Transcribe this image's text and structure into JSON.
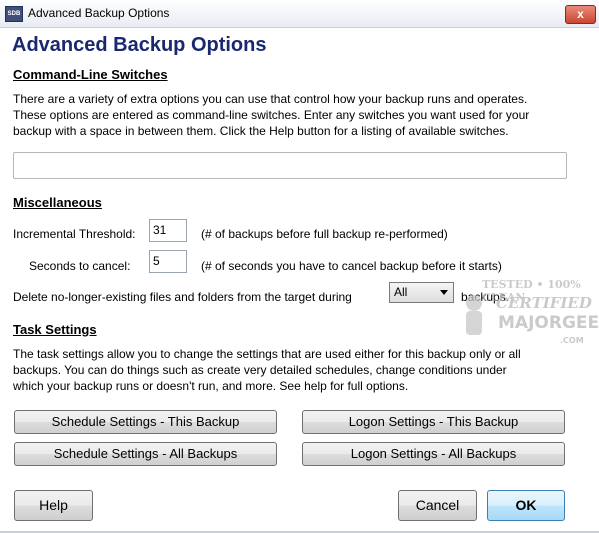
{
  "window": {
    "title": "Advanced Backup Options",
    "close_glyph": "x",
    "icon": "app-icon",
    "icon_text": "SDB"
  },
  "heading": "Advanced Backup Options",
  "cmdline": {
    "heading": "Command-Line Switches",
    "description_lines": [
      "There are a variety of extra options you can use that control how your backup runs and operates.",
      "These options are entered as command-line switches. Enter any switches you want used for your",
      "backup with a space in between them. Click the Help button for a listing of available switches."
    ],
    "switches_value": ""
  },
  "misc": {
    "heading": "Miscellaneous",
    "incremental_label": "Incremental Threshold:",
    "incremental_value": "31",
    "incremental_hint": "(# of backups before full backup re-performed)",
    "seconds_label": "Seconds to cancel:",
    "seconds_value": "5",
    "seconds_hint": "(# of seconds you have to cancel backup before it starts)",
    "delete_label": "Delete no-longer-existing files and folders from the target during",
    "delete_option": "All",
    "delete_suffix": "backups."
  },
  "task": {
    "heading": "Task Settings",
    "description_lines": [
      "The task settings allow you to change the settings that are used either for this backup only or all",
      "backups. You can do things such as create very detailed schedules, change conditions under",
      "which your backup runs or doesn't run, and more. See help for full options."
    ],
    "buttons": {
      "schedule_this": "Schedule Settings - This Backup",
      "logon_this": "Logon Settings - This Backup",
      "schedule_all": "Schedule Settings - All Backups",
      "logon_all": "Logon Settings - All Backups"
    }
  },
  "footer": {
    "help": "Help",
    "cancel": "Cancel",
    "ok": "OK"
  },
  "watermark": {
    "line1": "TESTED • 100% CLEAN",
    "line2": "CERTIFIED",
    "line3": "MAJORGEEKS",
    "line4": ".COM"
  },
  "colors": {
    "heading": "#1a2870",
    "ok_border": "#3c7fb1",
    "close": "#c94631"
  }
}
